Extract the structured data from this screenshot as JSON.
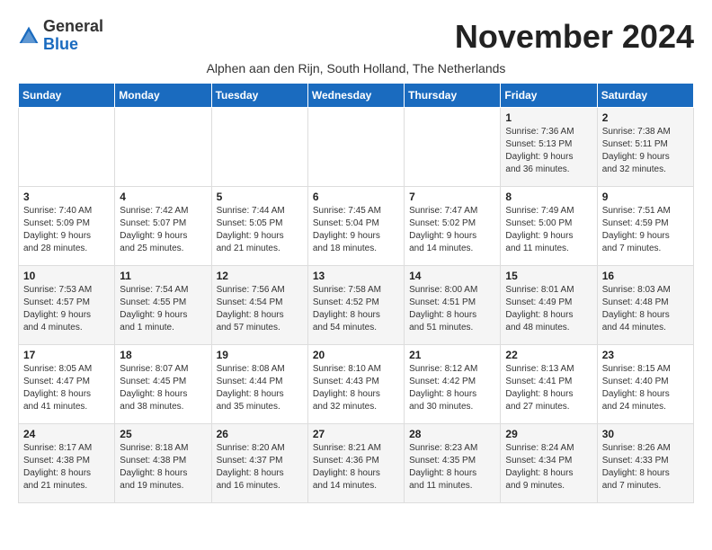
{
  "header": {
    "logo_general": "General",
    "logo_blue": "Blue",
    "month_title": "November 2024",
    "subtitle": "Alphen aan den Rijn, South Holland, The Netherlands"
  },
  "weekdays": [
    "Sunday",
    "Monday",
    "Tuesday",
    "Wednesday",
    "Thursday",
    "Friday",
    "Saturday"
  ],
  "weeks": [
    [
      {
        "day": "",
        "info": ""
      },
      {
        "day": "",
        "info": ""
      },
      {
        "day": "",
        "info": ""
      },
      {
        "day": "",
        "info": ""
      },
      {
        "day": "",
        "info": ""
      },
      {
        "day": "1",
        "info": "Sunrise: 7:36 AM\nSunset: 5:13 PM\nDaylight: 9 hours\nand 36 minutes."
      },
      {
        "day": "2",
        "info": "Sunrise: 7:38 AM\nSunset: 5:11 PM\nDaylight: 9 hours\nand 32 minutes."
      }
    ],
    [
      {
        "day": "3",
        "info": "Sunrise: 7:40 AM\nSunset: 5:09 PM\nDaylight: 9 hours\nand 28 minutes."
      },
      {
        "day": "4",
        "info": "Sunrise: 7:42 AM\nSunset: 5:07 PM\nDaylight: 9 hours\nand 25 minutes."
      },
      {
        "day": "5",
        "info": "Sunrise: 7:44 AM\nSunset: 5:05 PM\nDaylight: 9 hours\nand 21 minutes."
      },
      {
        "day": "6",
        "info": "Sunrise: 7:45 AM\nSunset: 5:04 PM\nDaylight: 9 hours\nand 18 minutes."
      },
      {
        "day": "7",
        "info": "Sunrise: 7:47 AM\nSunset: 5:02 PM\nDaylight: 9 hours\nand 14 minutes."
      },
      {
        "day": "8",
        "info": "Sunrise: 7:49 AM\nSunset: 5:00 PM\nDaylight: 9 hours\nand 11 minutes."
      },
      {
        "day": "9",
        "info": "Sunrise: 7:51 AM\nSunset: 4:59 PM\nDaylight: 9 hours\nand 7 minutes."
      }
    ],
    [
      {
        "day": "10",
        "info": "Sunrise: 7:53 AM\nSunset: 4:57 PM\nDaylight: 9 hours\nand 4 minutes."
      },
      {
        "day": "11",
        "info": "Sunrise: 7:54 AM\nSunset: 4:55 PM\nDaylight: 9 hours\nand 1 minute."
      },
      {
        "day": "12",
        "info": "Sunrise: 7:56 AM\nSunset: 4:54 PM\nDaylight: 8 hours\nand 57 minutes."
      },
      {
        "day": "13",
        "info": "Sunrise: 7:58 AM\nSunset: 4:52 PM\nDaylight: 8 hours\nand 54 minutes."
      },
      {
        "day": "14",
        "info": "Sunrise: 8:00 AM\nSunset: 4:51 PM\nDaylight: 8 hours\nand 51 minutes."
      },
      {
        "day": "15",
        "info": "Sunrise: 8:01 AM\nSunset: 4:49 PM\nDaylight: 8 hours\nand 48 minutes."
      },
      {
        "day": "16",
        "info": "Sunrise: 8:03 AM\nSunset: 4:48 PM\nDaylight: 8 hours\nand 44 minutes."
      }
    ],
    [
      {
        "day": "17",
        "info": "Sunrise: 8:05 AM\nSunset: 4:47 PM\nDaylight: 8 hours\nand 41 minutes."
      },
      {
        "day": "18",
        "info": "Sunrise: 8:07 AM\nSunset: 4:45 PM\nDaylight: 8 hours\nand 38 minutes."
      },
      {
        "day": "19",
        "info": "Sunrise: 8:08 AM\nSunset: 4:44 PM\nDaylight: 8 hours\nand 35 minutes."
      },
      {
        "day": "20",
        "info": "Sunrise: 8:10 AM\nSunset: 4:43 PM\nDaylight: 8 hours\nand 32 minutes."
      },
      {
        "day": "21",
        "info": "Sunrise: 8:12 AM\nSunset: 4:42 PM\nDaylight: 8 hours\nand 30 minutes."
      },
      {
        "day": "22",
        "info": "Sunrise: 8:13 AM\nSunset: 4:41 PM\nDaylight: 8 hours\nand 27 minutes."
      },
      {
        "day": "23",
        "info": "Sunrise: 8:15 AM\nSunset: 4:40 PM\nDaylight: 8 hours\nand 24 minutes."
      }
    ],
    [
      {
        "day": "24",
        "info": "Sunrise: 8:17 AM\nSunset: 4:38 PM\nDaylight: 8 hours\nand 21 minutes."
      },
      {
        "day": "25",
        "info": "Sunrise: 8:18 AM\nSunset: 4:38 PM\nDaylight: 8 hours\nand 19 minutes."
      },
      {
        "day": "26",
        "info": "Sunrise: 8:20 AM\nSunset: 4:37 PM\nDaylight: 8 hours\nand 16 minutes."
      },
      {
        "day": "27",
        "info": "Sunrise: 8:21 AM\nSunset: 4:36 PM\nDaylight: 8 hours\nand 14 minutes."
      },
      {
        "day": "28",
        "info": "Sunrise: 8:23 AM\nSunset: 4:35 PM\nDaylight: 8 hours\nand 11 minutes."
      },
      {
        "day": "29",
        "info": "Sunrise: 8:24 AM\nSunset: 4:34 PM\nDaylight: 8 hours\nand 9 minutes."
      },
      {
        "day": "30",
        "info": "Sunrise: 8:26 AM\nSunset: 4:33 PM\nDaylight: 8 hours\nand 7 minutes."
      }
    ]
  ]
}
